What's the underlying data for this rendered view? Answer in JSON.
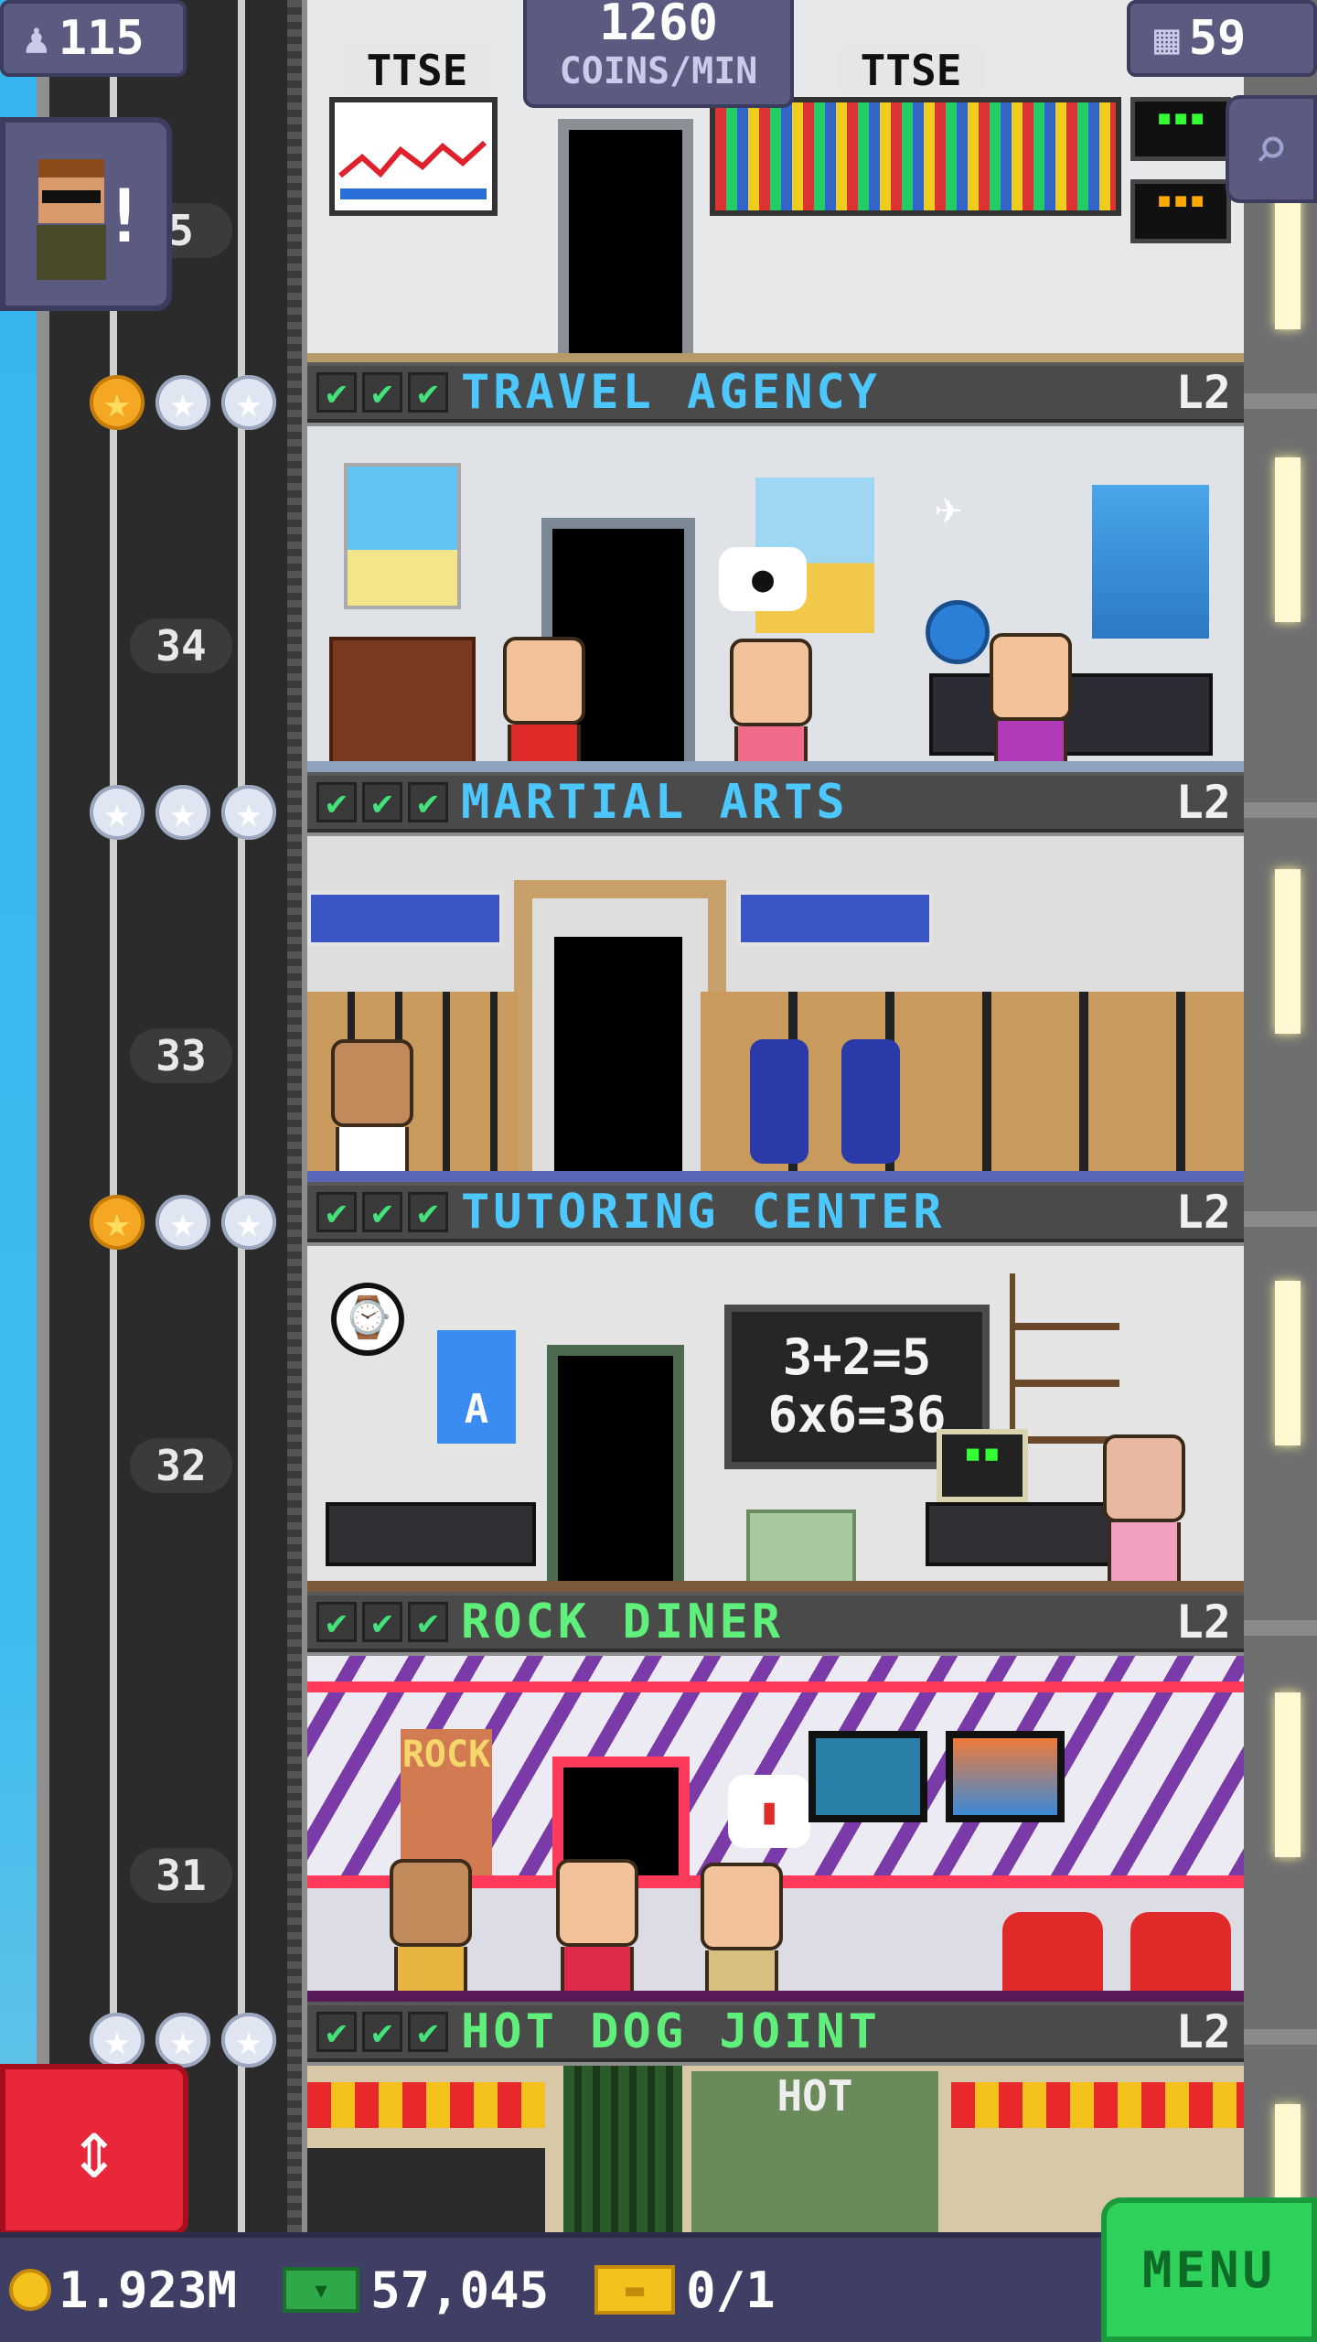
{
  "top_stats": {
    "population": "115",
    "coins_per_min_value": "1260",
    "coins_per_min_label": "COINS/MIN",
    "floors_count": "59"
  },
  "top_floor": {
    "sign_left": "TTSE",
    "sign_right": "TTSE",
    "partial_number": "5"
  },
  "floors": [
    {
      "name": "TRAVEL AGENCY",
      "level": "L2",
      "number": "34",
      "stars": [
        "gold",
        "silver",
        "silver"
      ],
      "color": "blue"
    },
    {
      "name": "MARTIAL ARTS",
      "level": "L2",
      "number": "33",
      "stars": [
        "silver",
        "silver",
        "silver"
      ],
      "color": "blue"
    },
    {
      "name": "TUTORING CENTER",
      "level": "L2",
      "number": "32",
      "stars": [
        "gold",
        "silver",
        "silver"
      ],
      "color": "blue"
    },
    {
      "name": "ROCK DINER",
      "level": "L2",
      "number": "31",
      "stars": [],
      "color": "green"
    },
    {
      "name": "HOT DOG JOINT",
      "level": "L2",
      "number": "",
      "stars": [
        "silver",
        "silver",
        "silver"
      ],
      "color": "green"
    }
  ],
  "tutoring": {
    "board_line1": "3+2=5",
    "board_line2": "6x6=36",
    "poster_letter": "A"
  },
  "diner_sign": "ROCK",
  "hotdog_sign": "HOT",
  "bottom_bar": {
    "coins": "1.923M",
    "bux": "57,045",
    "tickets": "0/1",
    "menu_label": "MENU"
  },
  "colors": {
    "accent_blue": "#4cc8ff",
    "accent_green": "#5ef07a",
    "panel": "#5b5b82",
    "menu_green": "#2ed15a",
    "elevator_red": "#e8283a"
  }
}
